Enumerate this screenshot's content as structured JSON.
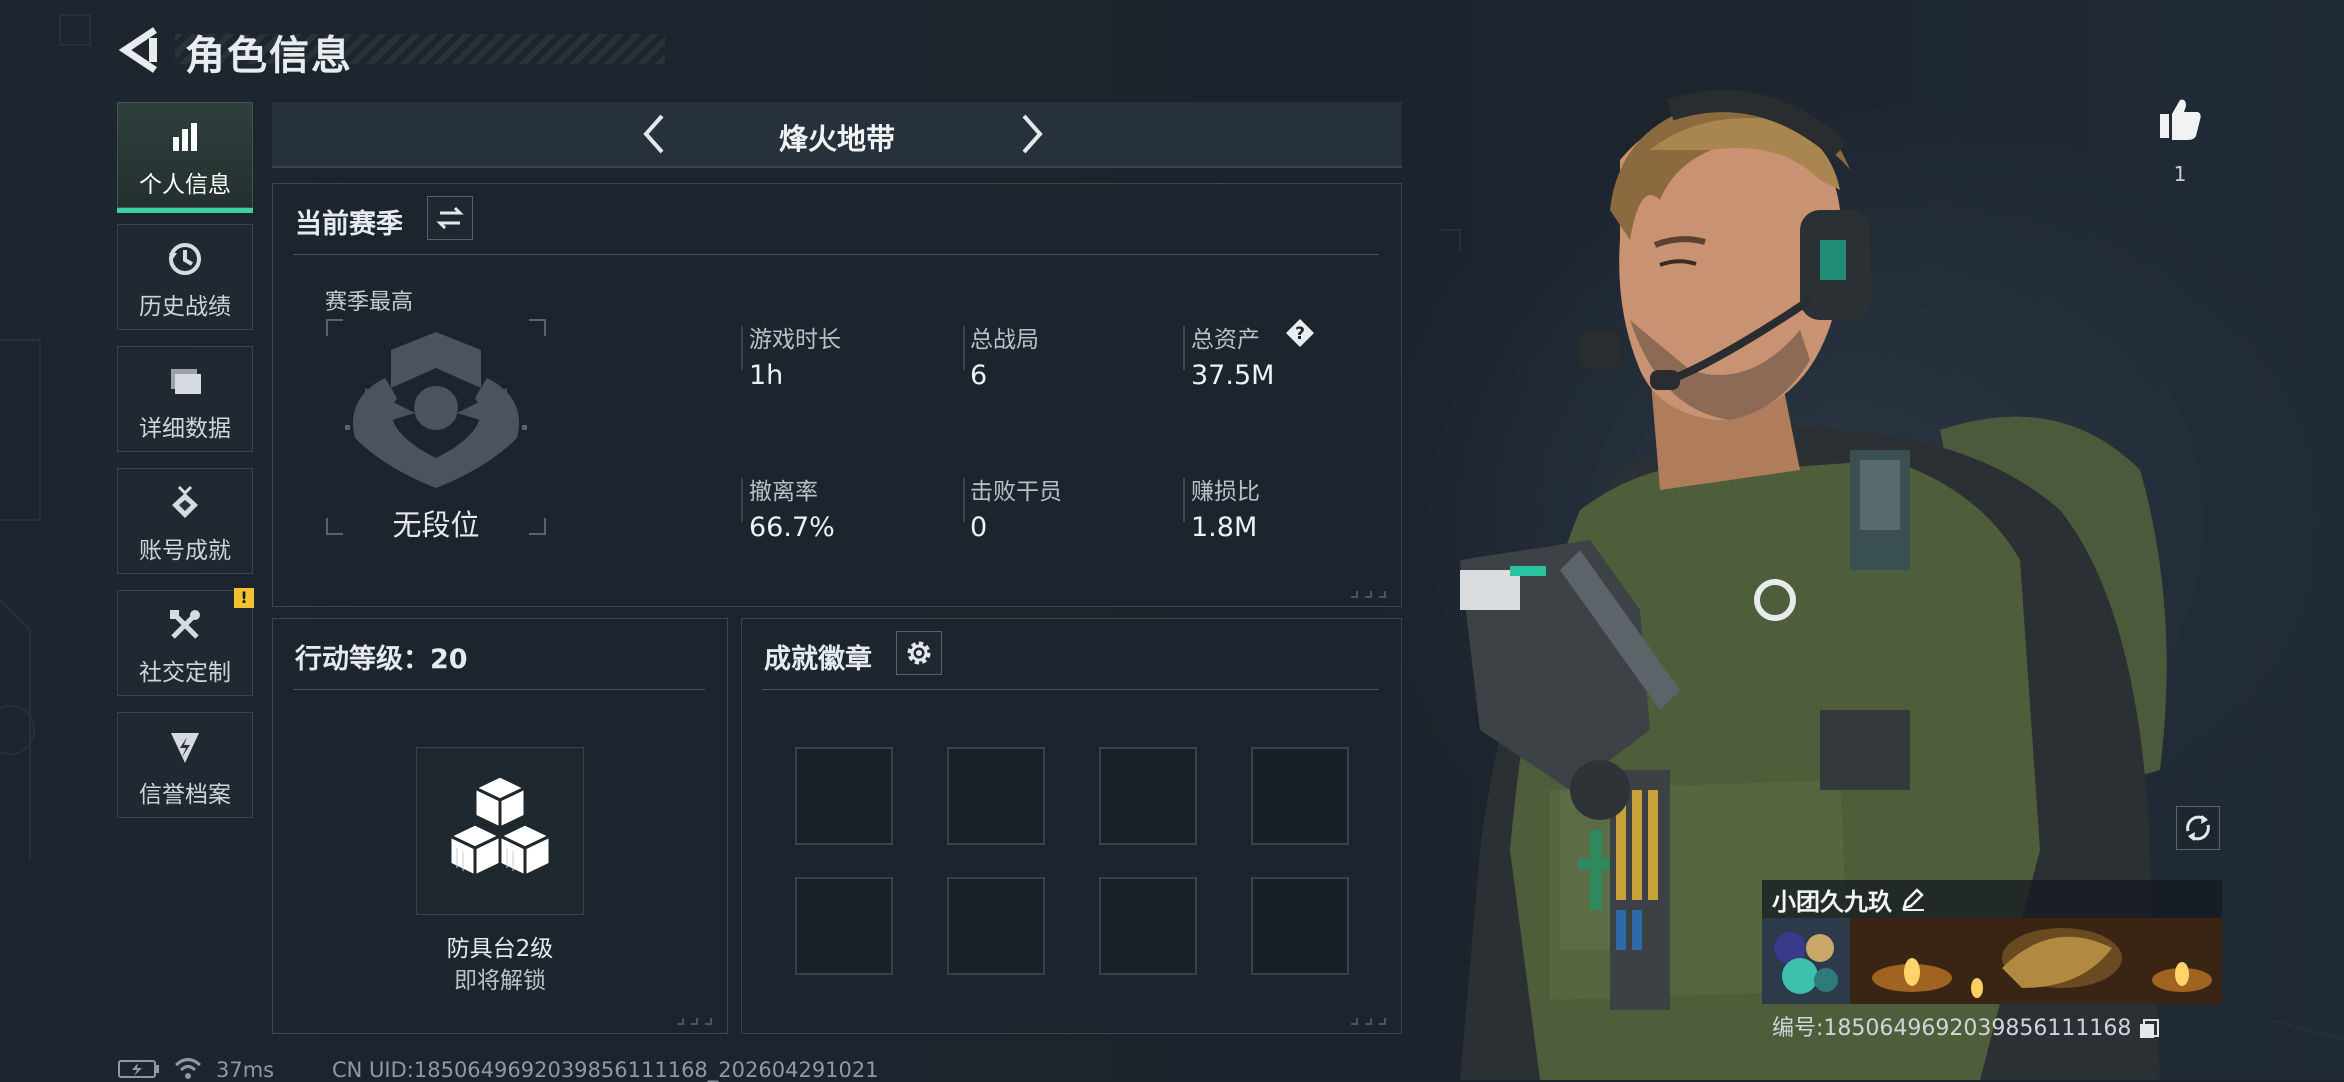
{
  "header": {
    "title": "角色信息"
  },
  "sidebar": {
    "items": [
      {
        "label": "个人信息",
        "icon": "bar-chart-icon",
        "active": true
      },
      {
        "label": "历史战绩",
        "icon": "history-clock-icon",
        "active": false
      },
      {
        "label": "详细数据",
        "icon": "folder-icon",
        "active": false
      },
      {
        "label": "账号成就",
        "icon": "medal-icon",
        "active": false
      },
      {
        "label": "社交定制",
        "icon": "tools-icon",
        "active": false,
        "badge": "!"
      },
      {
        "label": "信誉档案",
        "icon": "shield-bolt-icon",
        "active": false
      }
    ]
  },
  "mode": {
    "title": "烽火地带"
  },
  "season": {
    "title": "当前赛季",
    "best_label": "赛季最高",
    "rank": "无段位",
    "stats": [
      {
        "label": "游戏时长",
        "value": "1h"
      },
      {
        "label": "总战局",
        "value": "6"
      },
      {
        "label": "总资产",
        "value": "37.5M",
        "help": "?"
      },
      {
        "label": "撤离率",
        "value": "66.7%"
      },
      {
        "label": "击败干员",
        "value": "0"
      },
      {
        "label": "赚损比",
        "value": "1.8M"
      }
    ]
  },
  "level": {
    "title": "行动等级：20",
    "unlock_name": "防具台2级",
    "unlock_status": "即将解锁"
  },
  "achievements": {
    "title": "成就徽章",
    "slots": 8
  },
  "character": {
    "likes": "1",
    "name": "小团久九玖",
    "uid_label": "编号:1850649692039856111168"
  },
  "footer": {
    "ping": "37ms",
    "cn_uid": "CN UID:1850649692039856111168_202604291021"
  },
  "colors": {
    "accent": "#38d3a0",
    "warning": "#f2c230",
    "bg": "#1a222b"
  }
}
